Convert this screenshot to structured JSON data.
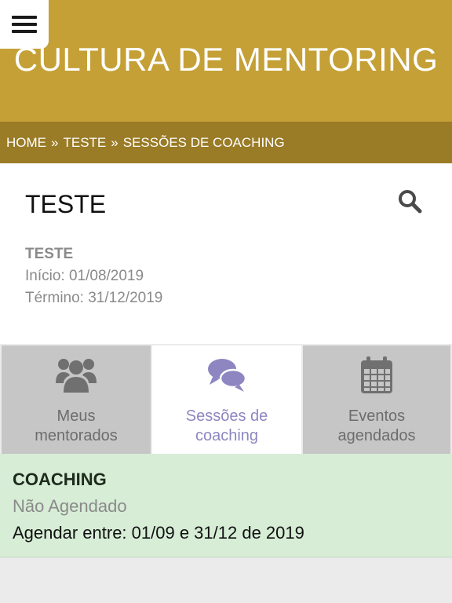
{
  "header": {
    "title": "CULTURA DE MENTORING",
    "menu_icon": "hamburger-menu-icon",
    "color": "#c4a036"
  },
  "breadcrumb": {
    "items": [
      "HOME",
      "TESTE",
      "SESSÕES DE COACHING"
    ],
    "separator": "»",
    "color": "#9a7b26"
  },
  "program": {
    "title": "TESTE",
    "name": "TESTE",
    "start": "Início: 01/08/2019",
    "end": "Término: 31/12/2019",
    "search_icon": "search-icon"
  },
  "tabs": [
    {
      "label_line1": "Meus",
      "label_line2": "mentorados",
      "icon": "users-icon",
      "active": false
    },
    {
      "label_line1": "Sessões de",
      "label_line2": "coaching",
      "icon": "chat-bubbles-icon",
      "active": true
    },
    {
      "label_line1": "Eventos",
      "label_line2": "agendados",
      "icon": "calendar-icon",
      "active": false
    }
  ],
  "session": {
    "title": "COACHING",
    "status": "Não Agendado",
    "range": "Agendar entre: 01/09 e 31/12 de 2019",
    "color": "#d7edd6"
  },
  "colors": {
    "accent_tab": "#8d86c0",
    "inactive_tab": "#c6c6c6",
    "icon_gray": "#707070"
  }
}
